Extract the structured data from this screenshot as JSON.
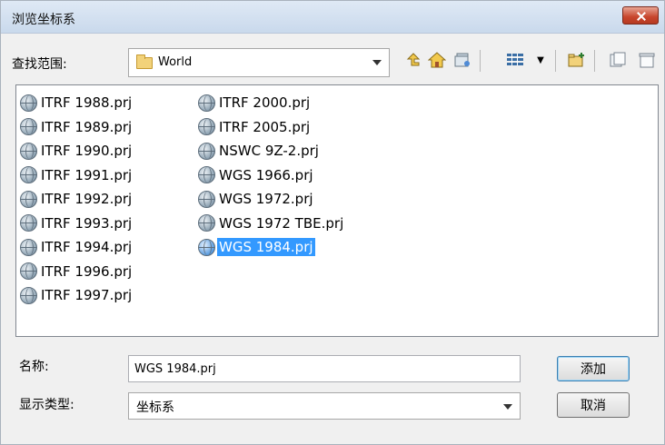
{
  "dialog": {
    "title": "浏览坐标系"
  },
  "look_in": {
    "label": "查找范围:",
    "value": "World"
  },
  "toolbar": {
    "icons": [
      "up-one-level-icon",
      "home-icon",
      "connect-folder-icon",
      "view-menu-icon",
      "new-folder-icon",
      "copy-icon",
      "delete-icon"
    ]
  },
  "files": {
    "column1": [
      "ITRF 1988.prj",
      "ITRF 1989.prj",
      "ITRF 1990.prj",
      "ITRF 1991.prj",
      "ITRF 1992.prj",
      "ITRF 1993.prj",
      "ITRF 1994.prj",
      "ITRF 1996.prj",
      "ITRF 1997.prj"
    ],
    "column2": [
      "ITRF 2000.prj",
      "ITRF 2005.prj",
      "NSWC 9Z-2.prj",
      "WGS 1966.prj",
      "WGS 1972.prj",
      "WGS 1972 TBE.prj",
      "WGS 1984.prj"
    ],
    "selected": "WGS 1984.prj"
  },
  "name_field": {
    "label": "名称:",
    "value": "WGS 1984.prj"
  },
  "type_field": {
    "label": "显示类型:",
    "value": "坐标系"
  },
  "buttons": {
    "add": "添加",
    "cancel": "取消"
  },
  "colors": {
    "selection": "#3399ff",
    "close_button": "#c7452c"
  }
}
